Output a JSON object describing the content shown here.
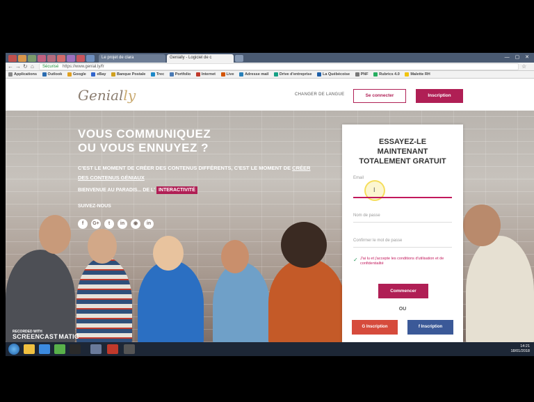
{
  "browser": {
    "tabs": [
      {
        "label": "Le projet de clara"
      },
      {
        "label": "Genially - Logiciel de c"
      }
    ],
    "url": "https://www.genial.ly/fr",
    "url_secure_label": "Sécurisé",
    "bookmarks": [
      "Applications",
      "Outlook",
      "Google",
      "eBay",
      "Banque Postale",
      "Trec",
      "Portfolio",
      "Internet",
      "Live",
      "Adresse mail",
      "Drive d'entreprise",
      "La Québécoise",
      "PNF",
      "Rubrics 4.0",
      "Malette RH"
    ]
  },
  "site": {
    "logo_main": "Genial",
    "logo_end": "ly",
    "lang_label": "CHANGER DE LANGUE",
    "login_label": "Se connecter",
    "signup_label": "Inscription"
  },
  "hero": {
    "headline_line1": "VOUS COMMUNIQUEZ",
    "headline_line2": "OU VOUS ENNUYEZ ?",
    "sub_part1": "C'EST LE MOMENT DE CRÉER DES CONTENUS DIFFÉRENTS, C'EST LE MOMENT DE ",
    "sub_link": "CRÉER DES CONTENUS GÉNIAUX",
    "welcome_text": "BIENVENUE AU PARADIS... DE L'",
    "welcome_badge": "INTERACTIVITÉ",
    "follow_text": "SUIVEZ-NOUS",
    "socials": [
      "f",
      "G+",
      "t",
      "in",
      "◉",
      "in"
    ]
  },
  "form": {
    "title_line1": "ESSAYEZ-LE",
    "title_line2": "MAINTENANT",
    "title_line3": "TOTALEMENT GRATUIT",
    "email_label": "Email",
    "username_placeholder": "Nom de passe",
    "confirm_placeholder": "Confirmer le mot de passe",
    "terms_text": "J'ai lu et j'accepte les conditions d'utilisation et de confidentialité",
    "submit_label": "Commencer",
    "or_label": "OU",
    "google_label": "G  Inscription",
    "facebook_label": "f  Inscription"
  },
  "taskbar": {
    "recorded_with": "RECORDED WITH",
    "screencast_label": "SCREENCAST",
    "matic_label": "MATIC",
    "time": "14:21",
    "date": "18/01/2018"
  },
  "colors": {
    "brand": "#b01f55",
    "google": "#d64b3c",
    "facebook": "#3b5998"
  }
}
